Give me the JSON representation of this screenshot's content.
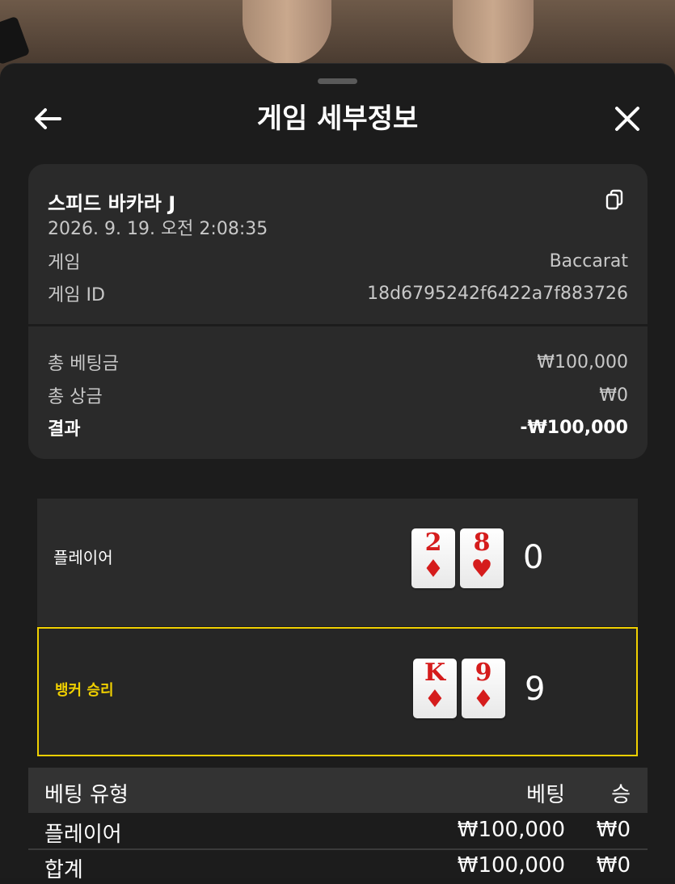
{
  "header": {
    "title": "게임 세부정보"
  },
  "game": {
    "name": "스피드 바카라 J",
    "datetime": "2026. 9. 19. 오전 2:08:35",
    "game_label": "게임",
    "game_value": "Baccarat",
    "id_label": "게임 ID",
    "id_value": "18d6795242f6422a7f883726"
  },
  "summary": {
    "total_bet_label": "총 베팅금",
    "total_bet_value": "₩100,000",
    "total_win_label": "총 상금",
    "total_win_value": "₩0",
    "result_label": "결과",
    "result_value": "-₩100,000"
  },
  "hands": {
    "player": {
      "label": "플레이어",
      "cards": [
        {
          "rank": "2",
          "suit": "♦"
        },
        {
          "rank": "8",
          "suit": "♥"
        }
      ],
      "score": "0"
    },
    "banker": {
      "label": "뱅커 승리",
      "cards": [
        {
          "rank": "K",
          "suit": "♦"
        },
        {
          "rank": "9",
          "suit": "♦"
        }
      ],
      "score": "9"
    }
  },
  "bets": {
    "headers": {
      "type": "베팅 유형",
      "bet": "베팅",
      "win": "승"
    },
    "rows": [
      {
        "type": "플레이어",
        "bet": "₩100,000",
        "win": "₩0"
      },
      {
        "type": "합계",
        "bet": "₩100,000",
        "win": "₩0"
      }
    ]
  },
  "colors": {
    "accent": "#f0d000",
    "card_red": "#d51c1c",
    "background": "#1c1c1c"
  },
  "icons": {
    "back": "arrow-left-icon",
    "close": "close-icon",
    "copy": "copy-icon"
  }
}
